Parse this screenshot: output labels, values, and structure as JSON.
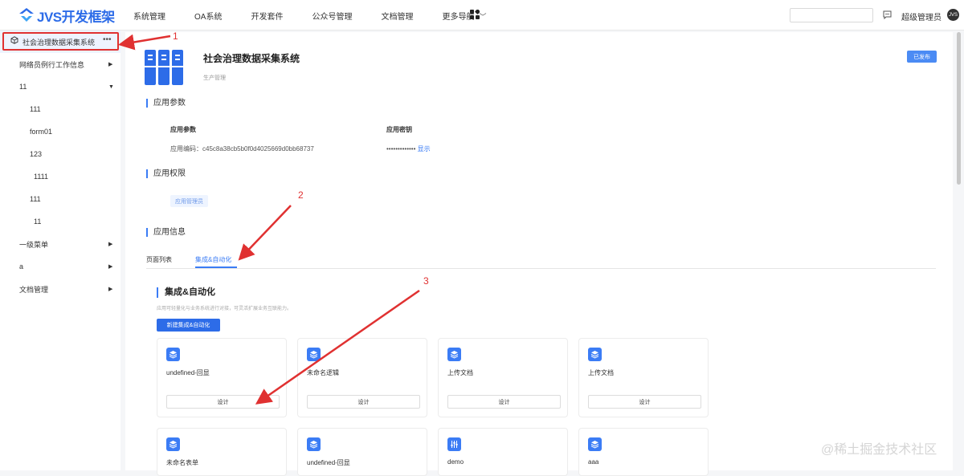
{
  "header": {
    "logo_text": "JVS开发框架",
    "nav": [
      "系统管理",
      "OA系统",
      "开发套件",
      "公众号管理",
      "文档管理",
      "更多导航"
    ],
    "user_name": "超级管理员",
    "avatar_text": "JVS"
  },
  "sidebar": {
    "items": [
      {
        "label": "社会治理数据采集系统",
        "dots": "•••"
      },
      {
        "label": "网络员例行工作信息"
      },
      {
        "label": "11"
      },
      {
        "label": "111"
      },
      {
        "label": "form01"
      },
      {
        "label": "123"
      },
      {
        "label": "1111"
      },
      {
        "label": "111"
      },
      {
        "label": "11"
      },
      {
        "label": "一级菜单"
      },
      {
        "label": "a"
      },
      {
        "label": "文档管理"
      }
    ]
  },
  "app": {
    "title": "社会治理数据采集系统",
    "subtitle": "生产管理",
    "status_button": "已发布",
    "params_section": "应用参数",
    "params_label": "应用参数",
    "code_text": "应用编码：c45c8a38cb5b0f0d4025669d0bb68737",
    "secret_label": "应用密钥",
    "secret_masked": "•••••••••••••",
    "secret_show": "显示",
    "perm_section": "应用权限",
    "role_tag": "应用管理员",
    "info_section": "应用信息",
    "tabs": [
      "页面列表",
      "集成&自动化"
    ]
  },
  "integration": {
    "title": "集成&自动化",
    "desc": "应用可轻量化与业务系统进行对接，可灵活扩展业务互联能力。",
    "new_button": "新建集成&自动化",
    "cards_row1": [
      {
        "name": "undefined-回显",
        "button": "设计"
      },
      {
        "name": "未命名逻辑",
        "button": "设计"
      },
      {
        "name": "上传文档",
        "button": "设计"
      },
      {
        "name": "上传文档",
        "button": "设计"
      }
    ],
    "cards_row2": [
      {
        "name": "未命名表单"
      },
      {
        "name": "undefined-回显"
      },
      {
        "name": "demo"
      },
      {
        "name": "aaa"
      }
    ]
  },
  "annotations": [
    "1",
    "2",
    "3"
  ],
  "watermark": "@稀土掘金技术社区",
  "colors": {
    "accent": "#3b7cf5",
    "annotation": "#e03131",
    "brand": "#2d6ce8"
  }
}
